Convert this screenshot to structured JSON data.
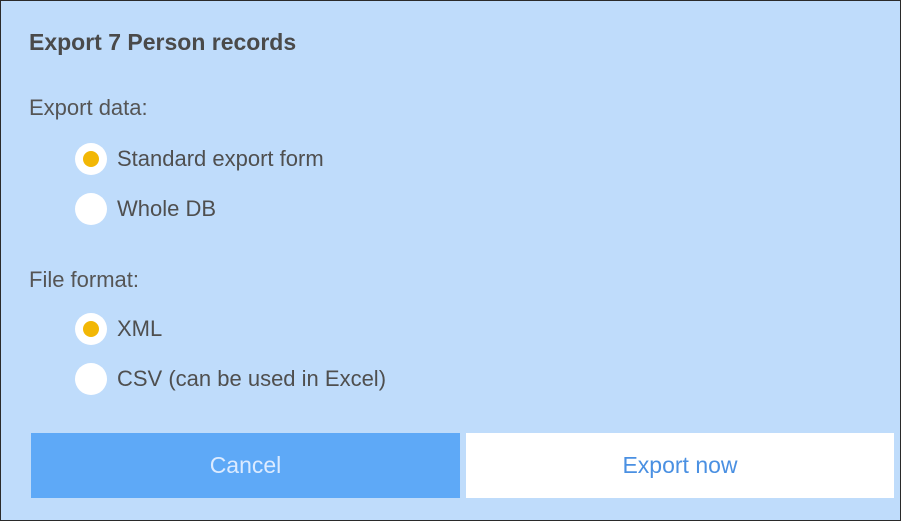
{
  "dialog": {
    "title": "Export 7 Person records",
    "export_data": {
      "label": "Export data:",
      "options": [
        {
          "label": "Standard export form",
          "selected": true
        },
        {
          "label": "Whole DB",
          "selected": false
        }
      ]
    },
    "file_format": {
      "label": "File format:",
      "options": [
        {
          "label": "XML",
          "selected": true
        },
        {
          "label": "CSV (can be used in Excel)",
          "selected": false
        }
      ]
    },
    "buttons": {
      "cancel_label": "Cancel",
      "export_label": "Export now"
    },
    "colors": {
      "background": "#bfdcfb",
      "radio_selected": "#f2b705",
      "cancel_button": "#5ea9f7",
      "export_text": "#4a90e2"
    }
  }
}
